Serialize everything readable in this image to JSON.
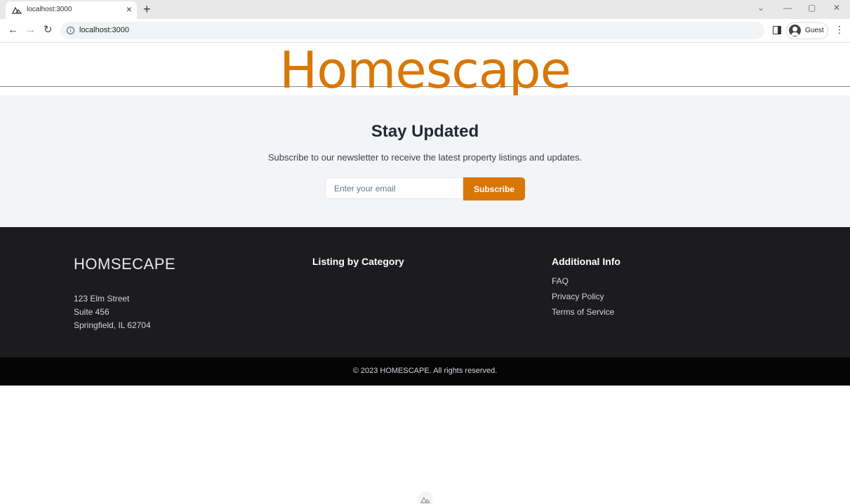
{
  "browser": {
    "tab_title": "localhost:3000",
    "tab_close": "×",
    "new_tab": "+",
    "url": "localhost:3000",
    "profile_label": "Guest",
    "back_icon": "←",
    "forward_icon": "→",
    "reload_icon": "↻",
    "info_icon": "i",
    "menu_icon": "⋮",
    "minimize": "—",
    "maximize": "▢",
    "close": "✕",
    "dropdown": "⌄"
  },
  "header": {
    "brand": "Homescape"
  },
  "newsletter": {
    "title": "Stay Updated",
    "description": "Subscribe to our newsletter to receive the latest property listings and updates.",
    "email_placeholder": "Enter your email",
    "subscribe_label": "Subscribe"
  },
  "footer": {
    "logo": "HOMSECAPE",
    "address": [
      "123 Elm Street",
      "Suite 456",
      "Springfield, IL 62704"
    ],
    "listing_heading": "Listing by Category",
    "info_heading": "Additional Info",
    "info_links": [
      "FAQ",
      "Privacy Policy",
      "Terms of Service"
    ],
    "copyright": "© 2023 HOMESCAPE. All rights reserved."
  },
  "colors": {
    "accent": "#d97706",
    "footer_bg": "#1c1c1e",
    "newsletter_bg": "#f3f4f6"
  }
}
